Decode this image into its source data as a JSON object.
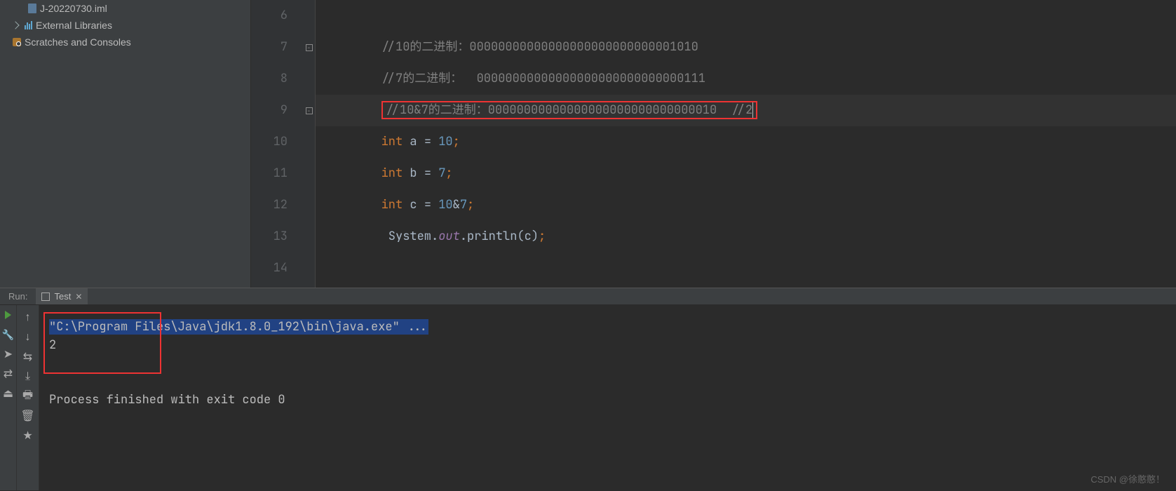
{
  "tree": {
    "items": [
      {
        "label": "J-20220730.iml",
        "level": 1,
        "icon": "file"
      },
      {
        "label": "External Libraries",
        "level": 0,
        "icon": "ext",
        "chevron": true
      },
      {
        "label": "Scratches and Consoles",
        "level": 0,
        "icon": "scratch"
      }
    ]
  },
  "editor": {
    "lines": [
      6,
      7,
      8,
      9,
      10,
      11,
      12,
      13,
      14
    ],
    "code": {
      "l6": "",
      "l7_comment": "//10的二进制：00000000000000000000000000001010",
      "l8_comment": "//7的二进制：  00000000000000000000000000000111",
      "l9_comment": "//10&7的二进制：00000000000000000000000000000010  //2",
      "l10": {
        "kw": "int",
        "mid": " a = ",
        "num": "10",
        "semi": ";"
      },
      "l11": {
        "kw": "int",
        "mid": " b = ",
        "num": "7",
        "semi": ";"
      },
      "l12": {
        "kw": "int",
        "mid": " c = ",
        "num": "10",
        "op": "&",
        "num2": "7",
        "semi": ";"
      },
      "l13": {
        "pre": " System.",
        "out": "out",
        "post": ".println(c)",
        "semi": ";"
      },
      "l14": ""
    },
    "indent": "        "
  },
  "run": {
    "panel_label": "Run:",
    "tab": "Test",
    "console": {
      "cmd": "\"C:\\Program Files\\Java\\jdk1.8.0_192\\bin\\java.exe\" ...",
      "output": "2",
      "exit": "Process finished with exit code 0"
    }
  },
  "watermark": "CSDN @徐憨憨！"
}
